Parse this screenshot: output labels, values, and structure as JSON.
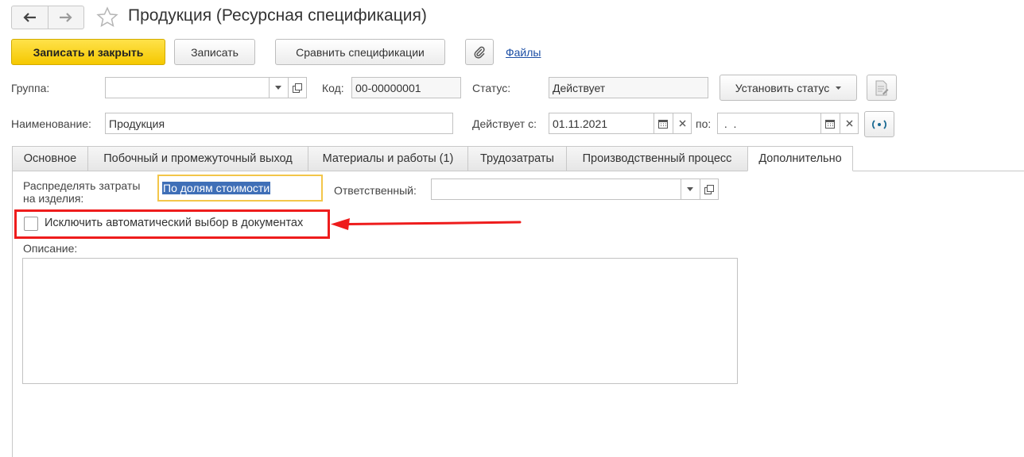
{
  "window": {
    "title": "Продукция (Ресурсная спецификация)",
    "back_icon": "arrow-left-icon",
    "forward_icon": "arrow-right-icon",
    "favorite_icon": "star-icon"
  },
  "toolbar": {
    "save_close_label": "Записать и закрыть",
    "save_label": "Записать",
    "compare_label": "Сравнить спецификации",
    "attach_icon": "paperclip-icon",
    "files_link": "Файлы",
    "accent_color": "#f5c800"
  },
  "header": {
    "group_label": "Группа:",
    "group_value": "",
    "code_label": "Код:",
    "code_value": "00-00000001",
    "status_label": "Статус:",
    "status_value": "Действует",
    "set_status_label": "Установить статус",
    "name_label": "Наименование:",
    "name_value": "Продукция",
    "valid_from_label": "Действует с:",
    "valid_from_value": "01.11.2021",
    "valid_to_label": "по:",
    "valid_to_value": " .  .",
    "calendar_icon": "calendar-icon",
    "clear_icon": "close-icon"
  },
  "tabs": [
    {
      "label": "Основное",
      "active": false
    },
    {
      "label": "Побочный и промежуточный выход",
      "active": false
    },
    {
      "label": "Материалы и работы (1)",
      "active": false
    },
    {
      "label": "Трудозатраты",
      "active": false
    },
    {
      "label": "Производственный процесс",
      "active": false
    },
    {
      "label": "Дополнительно",
      "active": true
    }
  ],
  "additional": {
    "distribute_label_line1": "Распределять затраты",
    "distribute_label_line2": "на изделия:",
    "distribute_value": "По долям стоимости",
    "responsible_label": "Ответственный:",
    "responsible_value": "",
    "exclude_auto_label": "Исключить автоматический выбор в документах",
    "exclude_auto_checked": false,
    "description_label": "Описание:",
    "description_value": ""
  },
  "annotation": {
    "color": "#ee1c1c",
    "arrow_icon": "arrow-left-annotation-icon"
  }
}
